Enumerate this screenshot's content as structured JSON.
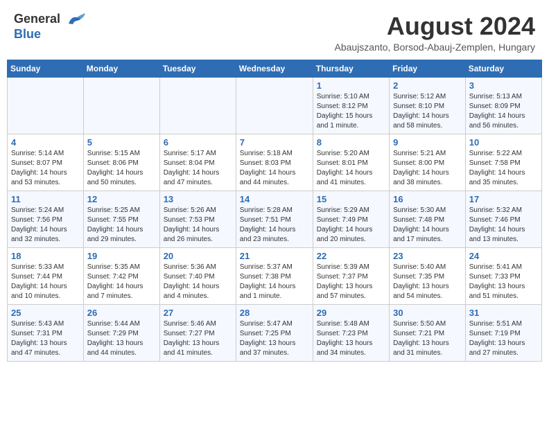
{
  "header": {
    "logo_general": "General",
    "logo_blue": "Blue",
    "title": "August 2024",
    "subtitle": "Abaujszanto, Borsod-Abauj-Zemplen, Hungary"
  },
  "weekdays": [
    "Sunday",
    "Monday",
    "Tuesday",
    "Wednesday",
    "Thursday",
    "Friday",
    "Saturday"
  ],
  "weeks": [
    [
      {
        "day": "",
        "info": ""
      },
      {
        "day": "",
        "info": ""
      },
      {
        "day": "",
        "info": ""
      },
      {
        "day": "",
        "info": ""
      },
      {
        "day": "1",
        "info": "Sunrise: 5:10 AM\nSunset: 8:12 PM\nDaylight: 15 hours\nand 1 minute."
      },
      {
        "day": "2",
        "info": "Sunrise: 5:12 AM\nSunset: 8:10 PM\nDaylight: 14 hours\nand 58 minutes."
      },
      {
        "day": "3",
        "info": "Sunrise: 5:13 AM\nSunset: 8:09 PM\nDaylight: 14 hours\nand 56 minutes."
      }
    ],
    [
      {
        "day": "4",
        "info": "Sunrise: 5:14 AM\nSunset: 8:07 PM\nDaylight: 14 hours\nand 53 minutes."
      },
      {
        "day": "5",
        "info": "Sunrise: 5:15 AM\nSunset: 8:06 PM\nDaylight: 14 hours\nand 50 minutes."
      },
      {
        "day": "6",
        "info": "Sunrise: 5:17 AM\nSunset: 8:04 PM\nDaylight: 14 hours\nand 47 minutes."
      },
      {
        "day": "7",
        "info": "Sunrise: 5:18 AM\nSunset: 8:03 PM\nDaylight: 14 hours\nand 44 minutes."
      },
      {
        "day": "8",
        "info": "Sunrise: 5:20 AM\nSunset: 8:01 PM\nDaylight: 14 hours\nand 41 minutes."
      },
      {
        "day": "9",
        "info": "Sunrise: 5:21 AM\nSunset: 8:00 PM\nDaylight: 14 hours\nand 38 minutes."
      },
      {
        "day": "10",
        "info": "Sunrise: 5:22 AM\nSunset: 7:58 PM\nDaylight: 14 hours\nand 35 minutes."
      }
    ],
    [
      {
        "day": "11",
        "info": "Sunrise: 5:24 AM\nSunset: 7:56 PM\nDaylight: 14 hours\nand 32 minutes."
      },
      {
        "day": "12",
        "info": "Sunrise: 5:25 AM\nSunset: 7:55 PM\nDaylight: 14 hours\nand 29 minutes."
      },
      {
        "day": "13",
        "info": "Sunrise: 5:26 AM\nSunset: 7:53 PM\nDaylight: 14 hours\nand 26 minutes."
      },
      {
        "day": "14",
        "info": "Sunrise: 5:28 AM\nSunset: 7:51 PM\nDaylight: 14 hours\nand 23 minutes."
      },
      {
        "day": "15",
        "info": "Sunrise: 5:29 AM\nSunset: 7:49 PM\nDaylight: 14 hours\nand 20 minutes."
      },
      {
        "day": "16",
        "info": "Sunrise: 5:30 AM\nSunset: 7:48 PM\nDaylight: 14 hours\nand 17 minutes."
      },
      {
        "day": "17",
        "info": "Sunrise: 5:32 AM\nSunset: 7:46 PM\nDaylight: 14 hours\nand 13 minutes."
      }
    ],
    [
      {
        "day": "18",
        "info": "Sunrise: 5:33 AM\nSunset: 7:44 PM\nDaylight: 14 hours\nand 10 minutes."
      },
      {
        "day": "19",
        "info": "Sunrise: 5:35 AM\nSunset: 7:42 PM\nDaylight: 14 hours\nand 7 minutes."
      },
      {
        "day": "20",
        "info": "Sunrise: 5:36 AM\nSunset: 7:40 PM\nDaylight: 14 hours\nand 4 minutes."
      },
      {
        "day": "21",
        "info": "Sunrise: 5:37 AM\nSunset: 7:38 PM\nDaylight: 14 hours\nand 1 minute."
      },
      {
        "day": "22",
        "info": "Sunrise: 5:39 AM\nSunset: 7:37 PM\nDaylight: 13 hours\nand 57 minutes."
      },
      {
        "day": "23",
        "info": "Sunrise: 5:40 AM\nSunset: 7:35 PM\nDaylight: 13 hours\nand 54 minutes."
      },
      {
        "day": "24",
        "info": "Sunrise: 5:41 AM\nSunset: 7:33 PM\nDaylight: 13 hours\nand 51 minutes."
      }
    ],
    [
      {
        "day": "25",
        "info": "Sunrise: 5:43 AM\nSunset: 7:31 PM\nDaylight: 13 hours\nand 47 minutes."
      },
      {
        "day": "26",
        "info": "Sunrise: 5:44 AM\nSunset: 7:29 PM\nDaylight: 13 hours\nand 44 minutes."
      },
      {
        "day": "27",
        "info": "Sunrise: 5:46 AM\nSunset: 7:27 PM\nDaylight: 13 hours\nand 41 minutes."
      },
      {
        "day": "28",
        "info": "Sunrise: 5:47 AM\nSunset: 7:25 PM\nDaylight: 13 hours\nand 37 minutes."
      },
      {
        "day": "29",
        "info": "Sunrise: 5:48 AM\nSunset: 7:23 PM\nDaylight: 13 hours\nand 34 minutes."
      },
      {
        "day": "30",
        "info": "Sunrise: 5:50 AM\nSunset: 7:21 PM\nDaylight: 13 hours\nand 31 minutes."
      },
      {
        "day": "31",
        "info": "Sunrise: 5:51 AM\nSunset: 7:19 PM\nDaylight: 13 hours\nand 27 minutes."
      }
    ]
  ]
}
